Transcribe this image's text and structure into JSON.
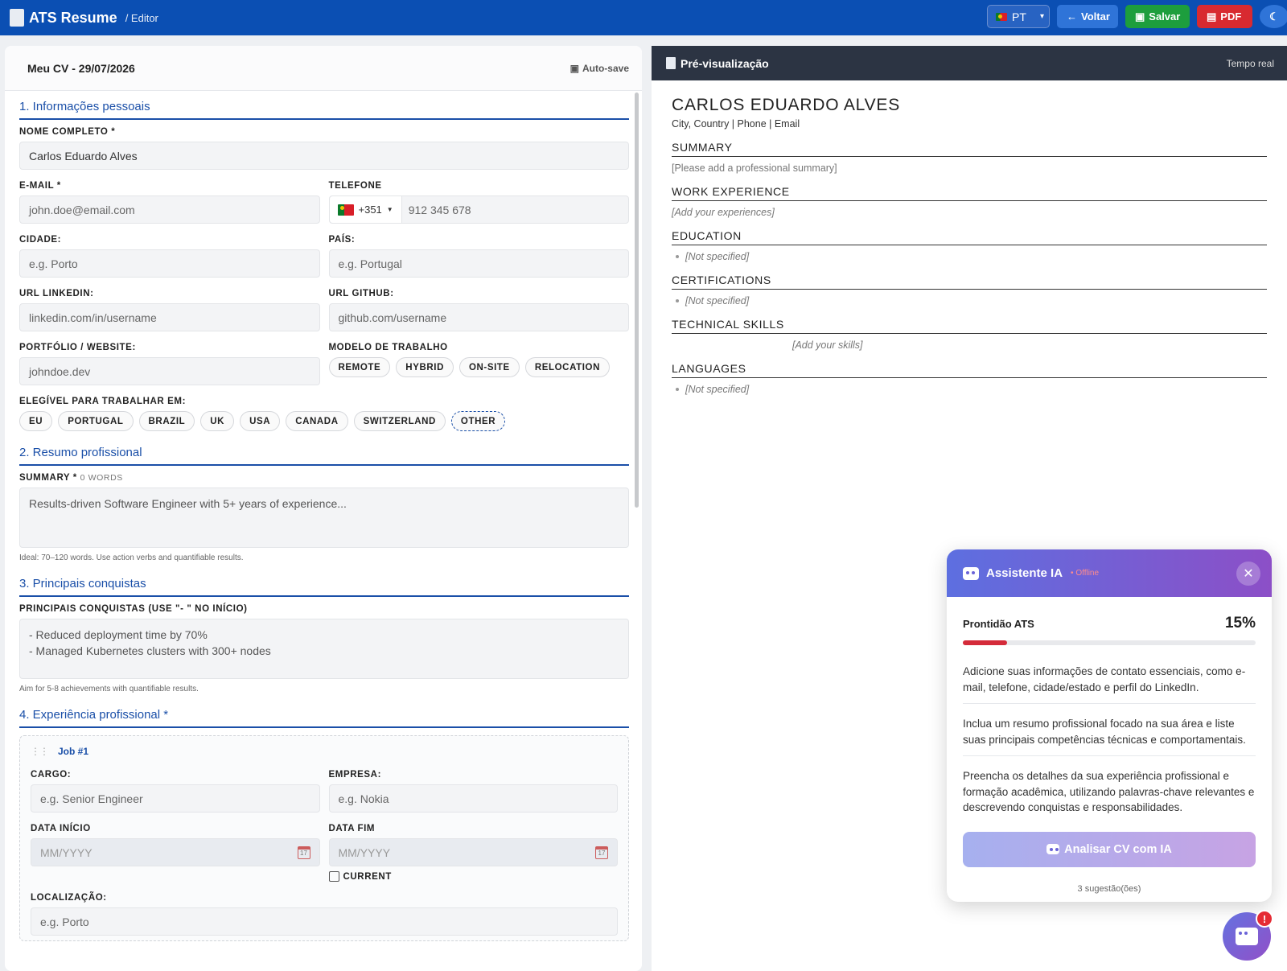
{
  "header": {
    "title": "ATS Resume",
    "crumb": "/ Editor",
    "lang": "PT",
    "back": "Voltar",
    "save": "Salvar",
    "pdf": "PDF"
  },
  "editor": {
    "cv_name": "Meu CV - 29/07/2026",
    "autosave": "Auto-save",
    "s1": "1. Informações pessoais",
    "name_label": "NOME COMPLETO *",
    "name_value": "Carlos Eduardo Alves",
    "email_label": "E-MAIL *",
    "email_ph": "john.doe@email.com",
    "phone_label": "TELEFONE",
    "phone_code": "+351",
    "phone_ph": "912 345 678",
    "city_label": "CIDADE:",
    "city_ph": "e.g. Porto",
    "country_label": "PAÍS:",
    "country_ph": "e.g. Portugal",
    "linkedin_label": "URL LINKEDIN:",
    "linkedin_ph": "linkedin.com/in/username",
    "github_label": "URL GITHUB:",
    "github_ph": "github.com/username",
    "portfolio_label": "PORTFÓLIO / WEBSITE:",
    "portfolio_ph": "johndoe.dev",
    "work_model_label": "MODELO DE TRABALHO",
    "work_models": [
      "REMOTE",
      "HYBRID",
      "ON-SITE",
      "RELOCATION"
    ],
    "eligible_label": "ELEGÍVEL PARA TRABALHAR EM:",
    "eligible": [
      "EU",
      "PORTUGAL",
      "BRAZIL",
      "UK",
      "USA",
      "CANADA",
      "SWITZERLAND",
      "OTHER"
    ],
    "s2": "2. Resumo profissional",
    "summary_label": "SUMMARY *",
    "summary_words": "0 WORDS",
    "summary_ph": "Results-driven Software Engineer with 5+ years of experience...",
    "summary_hint": "Ideal: 70–120 words. Use action verbs and quantifiable results.",
    "s3": "3. Principais conquistas",
    "ach_label": "PRINCIPAIS CONQUISTAS (USE \"- \" NO INÍCIO)",
    "ach_line1": "- Reduced deployment time by 70%",
    "ach_line2": "- Managed Kubernetes clusters with 300+ nodes",
    "ach_hint": "Aim for 5-8 achievements with quantifiable results.",
    "s4": "4. Experiência profissional *",
    "job_title": "Job #1",
    "cargo_label": "CARGO:",
    "cargo_ph": "e.g. Senior Engineer",
    "empresa_label": "EMPRESA:",
    "empresa_ph": "e.g. Nokia",
    "start_label": "DATA INÍCIO",
    "start_ph": "MM/YYYY",
    "end_label": "DATA FIM",
    "end_ph": "MM/YYYY",
    "cal_day": "17",
    "current_label": "CURRENT",
    "loc_label": "LOCALIZAÇÃO:",
    "loc_ph": "e.g. Porto"
  },
  "preview": {
    "title": "Pré-visualização",
    "realtime": "Tempo real",
    "name": "CARLOS EDUARDO ALVES",
    "contact": "City, Country | Phone | Email",
    "sections": {
      "summary": "SUMMARY",
      "summary_ph": "[Please add a professional summary]",
      "work": "WORK EXPERIENCE",
      "work_ph": "[Add your experiences]",
      "education": "EDUCATION",
      "education_ph": "[Not specified]",
      "certs": "CERTIFICATIONS",
      "certs_ph": "[Not specified]",
      "skills": "TECHNICAL SKILLS",
      "skills_ph": "[Add your skills]",
      "languages": "LANGUAGES",
      "languages_ph": "[Not specified]"
    }
  },
  "assistant": {
    "name": "Assistente IA",
    "status": "• Offline",
    "readiness_label": "Prontidão ATS",
    "readiness_value": "15%",
    "readiness_fraction": 0.15,
    "suggestions": [
      "Adicione suas informações de contato essenciais, como e-mail, telefone, cidade/estado e perfil do LinkedIn.",
      "Inclua um resumo profissional focado na sua área e liste suas principais competências técnicas e comportamentais.",
      "Preencha os detalhes da sua experiência profissional e formação acadêmica, utilizando palavras-chave relevantes e descrevendo conquistas e responsabilidades."
    ],
    "analyze": "Analisar CV com IA",
    "count": "3 sugestão(ões)",
    "fab_badge": "!"
  },
  "colors": {
    "primary": "#0b4fb3",
    "save": "#1d9e3d",
    "pdf": "#d82a30",
    "readiness": "#d42b3a"
  }
}
